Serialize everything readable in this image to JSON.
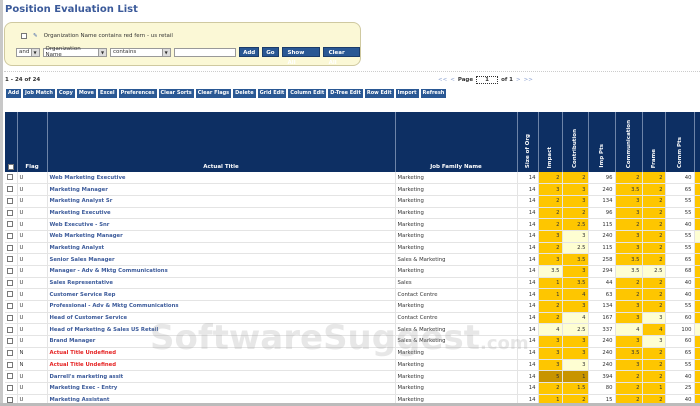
{
  "title": "Position Evaluation List",
  "filter": {
    "criteria": "Organization Name contains red fern - us retail",
    "conj": "and",
    "field": "Organization Name",
    "op": "contains",
    "value": "",
    "buttons": [
      "Add",
      "Go",
      "Show All",
      "Clear All"
    ]
  },
  "count": "1 - 24 of 24",
  "pager": {
    "first": "<<",
    "prev": "<",
    "label": "Page",
    "page": "1",
    "of": "of 1",
    "next": ">",
    "last": ">>"
  },
  "toolbar": [
    "Add",
    "Job Match",
    "Copy",
    "Move",
    "Excel",
    "Preferences",
    "Clear Sorts",
    "Clear Flags",
    "Delete",
    "Grid Edit",
    "Column Edit",
    "D-Tree Edit",
    "Row Edit",
    "Import",
    "Refresh"
  ],
  "columns": [
    "Flag",
    "Actual Title",
    "Job Family Name",
    "Size of Org",
    "Impact",
    "Contribution",
    "Imp Pts",
    "Communication",
    "Frame",
    "Comm Pts"
  ],
  "cell_colors": {
    "y": "#fec600",
    "l": "#fefed2",
    "d": "#c89400"
  },
  "rows": [
    [
      "U",
      "Web Marketing Executive",
      "Marketing",
      "14",
      "2",
      "2",
      "96",
      "2",
      "2",
      "40",
      "y",
      "y",
      "y",
      "y"
    ],
    [
      "U",
      "Marketing Manager",
      "Marketing",
      "14",
      "3",
      "3",
      "240",
      "3.5",
      "2",
      "65",
      "y",
      "y",
      "y",
      "y"
    ],
    [
      "U",
      "Marketing Analyst Sr",
      "Marketing",
      "14",
      "2",
      "3",
      "134",
      "3",
      "2",
      "55",
      "y",
      "y",
      "y",
      "y"
    ],
    [
      "U",
      "Marketing Executive",
      "Marketing",
      "14",
      "2",
      "2",
      "96",
      "3",
      "2",
      "55",
      "y",
      "y",
      "y",
      "y"
    ],
    [
      "U",
      "Web Executive - Snr",
      "Marketing",
      "14",
      "2",
      "2.5",
      "115",
      "2",
      "2",
      "40",
      "y",
      "y",
      "y",
      "y"
    ],
    [
      "U",
      "Web Marketing Manager",
      "Marketing",
      "14",
      "3",
      "3",
      "240",
      "3",
      "2",
      "55",
      "y",
      "l",
      "y",
      "y"
    ],
    [
      "U",
      "Marketing Analyst",
      "Marketing",
      "14",
      "2",
      "2.5",
      "115",
      "3",
      "2",
      "55",
      "y",
      "l",
      "y",
      "y"
    ],
    [
      "U",
      "Senior Sales Manager",
      "Sales & Marketing",
      "14",
      "3",
      "3.5",
      "258",
      "3.5",
      "2",
      "65",
      "y",
      "y",
      "y",
      "y"
    ],
    [
      "U",
      "Manager - Adv & Mktg Communications",
      "Marketing",
      "14",
      "3.5",
      "3",
      "294",
      "3.5",
      "2.5",
      "68",
      "l",
      "y",
      "l",
      "l"
    ],
    [
      "U",
      "Sales Representative",
      "Sales",
      "14",
      "1",
      "3.5",
      "44",
      "2",
      "2",
      "40",
      "y",
      "y",
      "y",
      "y"
    ],
    [
      "U",
      "Customer Service Rep",
      "Contact Centre",
      "14",
      "1",
      "4",
      "63",
      "2",
      "2",
      "40",
      "y",
      "y",
      "y",
      "y"
    ],
    [
      "U",
      "Professional - Adv & Mktg Communications",
      "Marketing",
      "14",
      "2",
      "3",
      "134",
      "3",
      "2",
      "55",
      "y",
      "y",
      "y",
      "y"
    ],
    [
      "U",
      "Head of Customer Service",
      "Contact Centre",
      "14",
      "2",
      "4",
      "167",
      "3",
      "3",
      "60",
      "y",
      "l",
      "y",
      "l"
    ],
    [
      "U",
      "Head of Marketing & Sales US Retail",
      "Sales & Marketing",
      "14",
      "4",
      "2.5",
      "337",
      "4",
      "4",
      "100",
      "l",
      "l",
      "l",
      "y"
    ],
    [
      "U",
      "Brand Manager",
      "Sales & Marketing",
      "14",
      "3",
      "3",
      "240",
      "3",
      "3",
      "60",
      "y",
      "y",
      "y",
      "l"
    ],
    [
      "N",
      "Actual Title Undefined",
      "Marketing",
      "14",
      "3",
      "3",
      "240",
      "3.5",
      "2",
      "65",
      "y",
      "y",
      "y",
      "y"
    ],
    [
      "N",
      "Actual Title Undefined",
      "Marketing",
      "14",
      "3",
      "3",
      "240",
      "3",
      "2",
      "55",
      "y",
      "l",
      "y",
      "y"
    ],
    [
      "U",
      "Darrell's marketing assit",
      "Marketing",
      "14",
      "5",
      "1",
      "394",
      "2",
      "2",
      "40",
      "d",
      "d",
      "y",
      "y"
    ],
    [
      "U",
      "Marketing Exec - Entry",
      "Marketing",
      "14",
      "2",
      "1.5",
      "80",
      "2",
      "1",
      "25",
      "y",
      "y",
      "y",
      "y"
    ],
    [
      "U",
      "Marketing Assistant",
      "Marketing",
      "14",
      "1",
      "2",
      "15",
      "2",
      "2",
      "40",
      "y",
      "y",
      "y",
      "y"
    ]
  ]
}
